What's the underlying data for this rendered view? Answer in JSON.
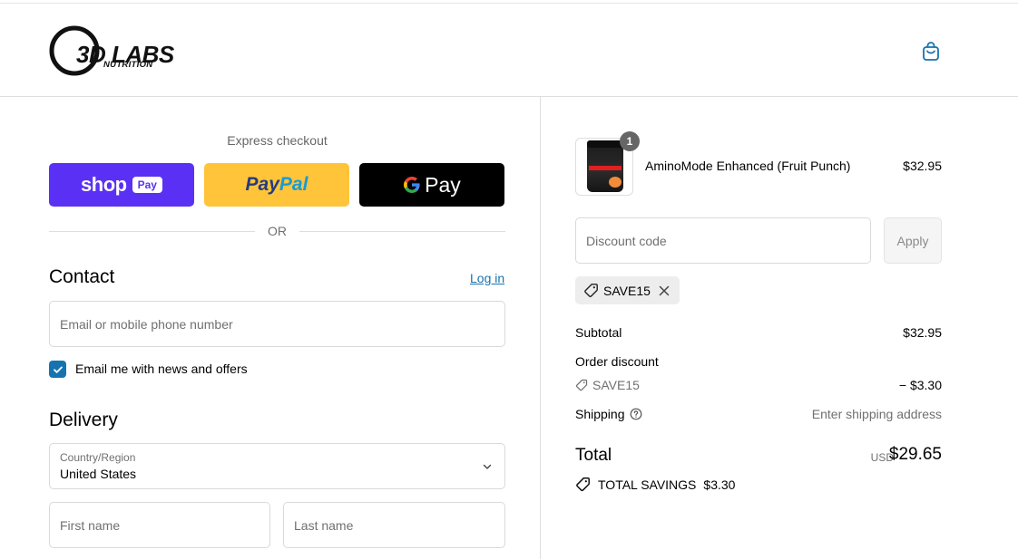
{
  "brand": {
    "logo_text": "3D LABS",
    "logo_sub": "NUTRITION"
  },
  "express": {
    "label": "Express checkout",
    "shop_pay": {
      "word": "shop",
      "pill": "Pay"
    },
    "paypal": {
      "pay": "Pay",
      "pal": "Pal"
    },
    "gpay": {
      "word": "Pay"
    },
    "or_text": "OR"
  },
  "contact": {
    "title": "Contact",
    "login": "Log in",
    "email_placeholder": "Email or mobile phone number",
    "newsletter_label": "Email me with news and offers",
    "newsletter_checked": true
  },
  "delivery": {
    "title": "Delivery",
    "country_label": "Country/Region",
    "country_value": "United States",
    "first_name_placeholder": "First name",
    "last_name_placeholder": "Last name"
  },
  "cart": {
    "item": {
      "name": "AminoMode Enhanced (Fruit Punch)",
      "price": "$32.95",
      "quantity": "1"
    },
    "discount_placeholder": "Discount code",
    "apply_label": "Apply",
    "applied_code": "SAVE15"
  },
  "summary": {
    "subtotal_label": "Subtotal",
    "subtotal_value": "$32.95",
    "order_discount_label": "Order discount",
    "discount_code": "SAVE15",
    "discount_value": "− $3.30",
    "shipping_label": "Shipping",
    "shipping_value": "Enter shipping address",
    "total_label": "Total",
    "currency": "USD",
    "total_value": "$29.65",
    "savings_label": "TOTAL SAVINGS",
    "savings_value": "$3.30"
  },
  "colors": {
    "shop_pay": "#5a31f4",
    "paypal": "#ffc439",
    "gpay": "#000000",
    "link": "#1773b0"
  }
}
